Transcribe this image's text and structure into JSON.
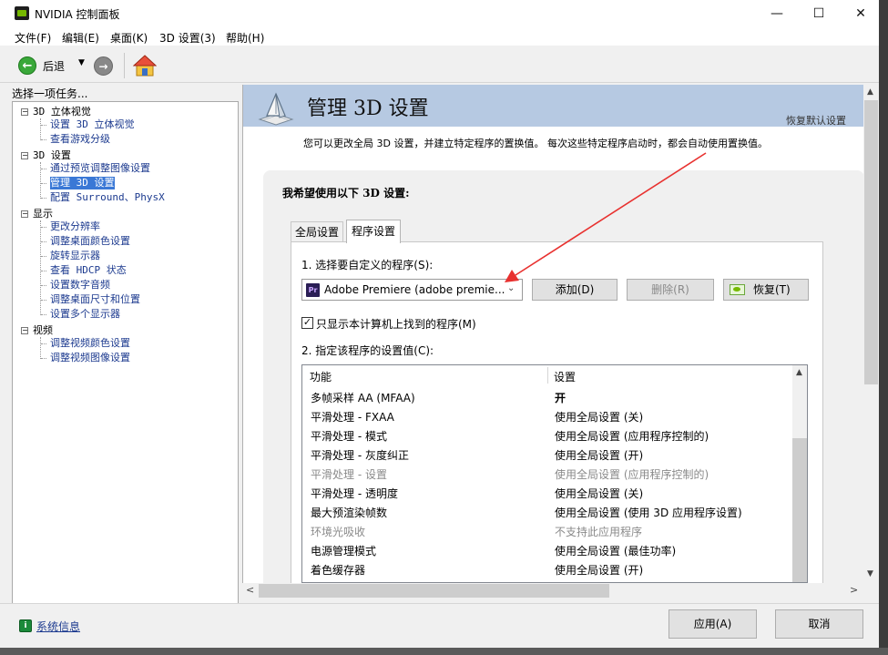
{
  "window": {
    "title": "NVIDIA 控制面板",
    "minimize": "—",
    "maximize": "☐",
    "close": "✕"
  },
  "menu": [
    "文件(F)",
    "编辑(E)",
    "桌面(K)",
    "3D 设置(3)",
    "帮助(H)"
  ],
  "toolbar": {
    "back_label": "后退",
    "back_icon": "arrow-left-icon",
    "forward_icon": "arrow-right-icon",
    "home_icon": "home-icon"
  },
  "tasks": {
    "label": "选择一项任务...",
    "categories": [
      {
        "name": "3D 立体视觉",
        "items": [
          "设置 3D 立体视觉",
          "查看游戏分级"
        ]
      },
      {
        "name": "3D 设置",
        "items": [
          "通过预览调整图像设置",
          "管理 3D 设置",
          "配置 Surround、PhysX"
        ]
      },
      {
        "name": "显示",
        "items": [
          "更改分辨率",
          "调整桌面颜色设置",
          "旋转显示器",
          "查看 HDCP 状态",
          "设置数字音频",
          "调整桌面尺寸和位置",
          "设置多个显示器"
        ]
      },
      {
        "name": "视频",
        "items": [
          "调整视频颜色设置",
          "调整视频图像设置"
        ]
      }
    ],
    "selected": "管理 3D 设置"
  },
  "page": {
    "title": "管理 3D 设置",
    "restore_defaults": "恢复默认设置",
    "description": "您可以更改全局 3D 设置，并建立特定程序的置换值。 每次这些特定程序启动时，都会自动使用置换值。",
    "heading": "我希望使用以下 3D 设置:",
    "tabs": [
      "全局设置",
      "程序设置"
    ],
    "active_tab": "程序设置"
  },
  "program_tab": {
    "select_label": "1. 选择要自定义的程序(S):",
    "selected_program": "Adobe Premiere (adobe premie...",
    "program_icon_text": "Pr",
    "add_button": "添加(D)",
    "remove_button": "删除(R)",
    "restore_button": "恢复(T)",
    "show_only_label": "只显示本计算机上找到的程序(M)",
    "show_only_checked": true,
    "check_mark": "✓",
    "settings_label": "2. 指定该程序的设置值(C):"
  },
  "feature_table": {
    "headers": [
      "功能",
      "设置"
    ],
    "rows": [
      {
        "feature": "多帧采样 AA (MFAA)",
        "setting": "开",
        "bold": true,
        "dim": false
      },
      {
        "feature": "平滑处理 - FXAA",
        "setting": "使用全局设置 (关)",
        "bold": false,
        "dim": false
      },
      {
        "feature": "平滑处理 - 模式",
        "setting": "使用全局设置 (应用程序控制的)",
        "bold": false,
        "dim": false
      },
      {
        "feature": "平滑处理 - 灰度纠正",
        "setting": "使用全局设置 (开)",
        "bold": false,
        "dim": false
      },
      {
        "feature": "平滑处理 - 设置",
        "setting": "使用全局设置 (应用程序控制的)",
        "bold": false,
        "dim": true
      },
      {
        "feature": "平滑处理 - 透明度",
        "setting": "使用全局设置 (关)",
        "bold": false,
        "dim": false
      },
      {
        "feature": "最大预渲染帧数",
        "setting": "使用全局设置 (使用 3D 应用程序设置)",
        "bold": false,
        "dim": false
      },
      {
        "feature": "环境光吸收",
        "setting": "不支持此应用程序",
        "bold": false,
        "dim": true
      },
      {
        "feature": "电源管理模式",
        "setting": "使用全局设置 (最佳功率)",
        "bold": false,
        "dim": false
      },
      {
        "feature": "着色缓存器",
        "setting": "使用全局设置 (开)",
        "bold": false,
        "dim": false
      }
    ]
  },
  "footer": {
    "system_info": "系统信息",
    "apply_button": "应用(A)",
    "cancel_button": "取消"
  },
  "colors": {
    "banner": "#b6c9e2",
    "nvidia_green": "#76b900",
    "selection": "#3a78d6",
    "link": "#1c3a8f",
    "annotation_arrow": "#e8312f"
  },
  "glyphs": {
    "up": "▲",
    "down": "▼",
    "left": "<",
    "right": ">",
    "caret": "⌄",
    "dropdown": "▼"
  }
}
